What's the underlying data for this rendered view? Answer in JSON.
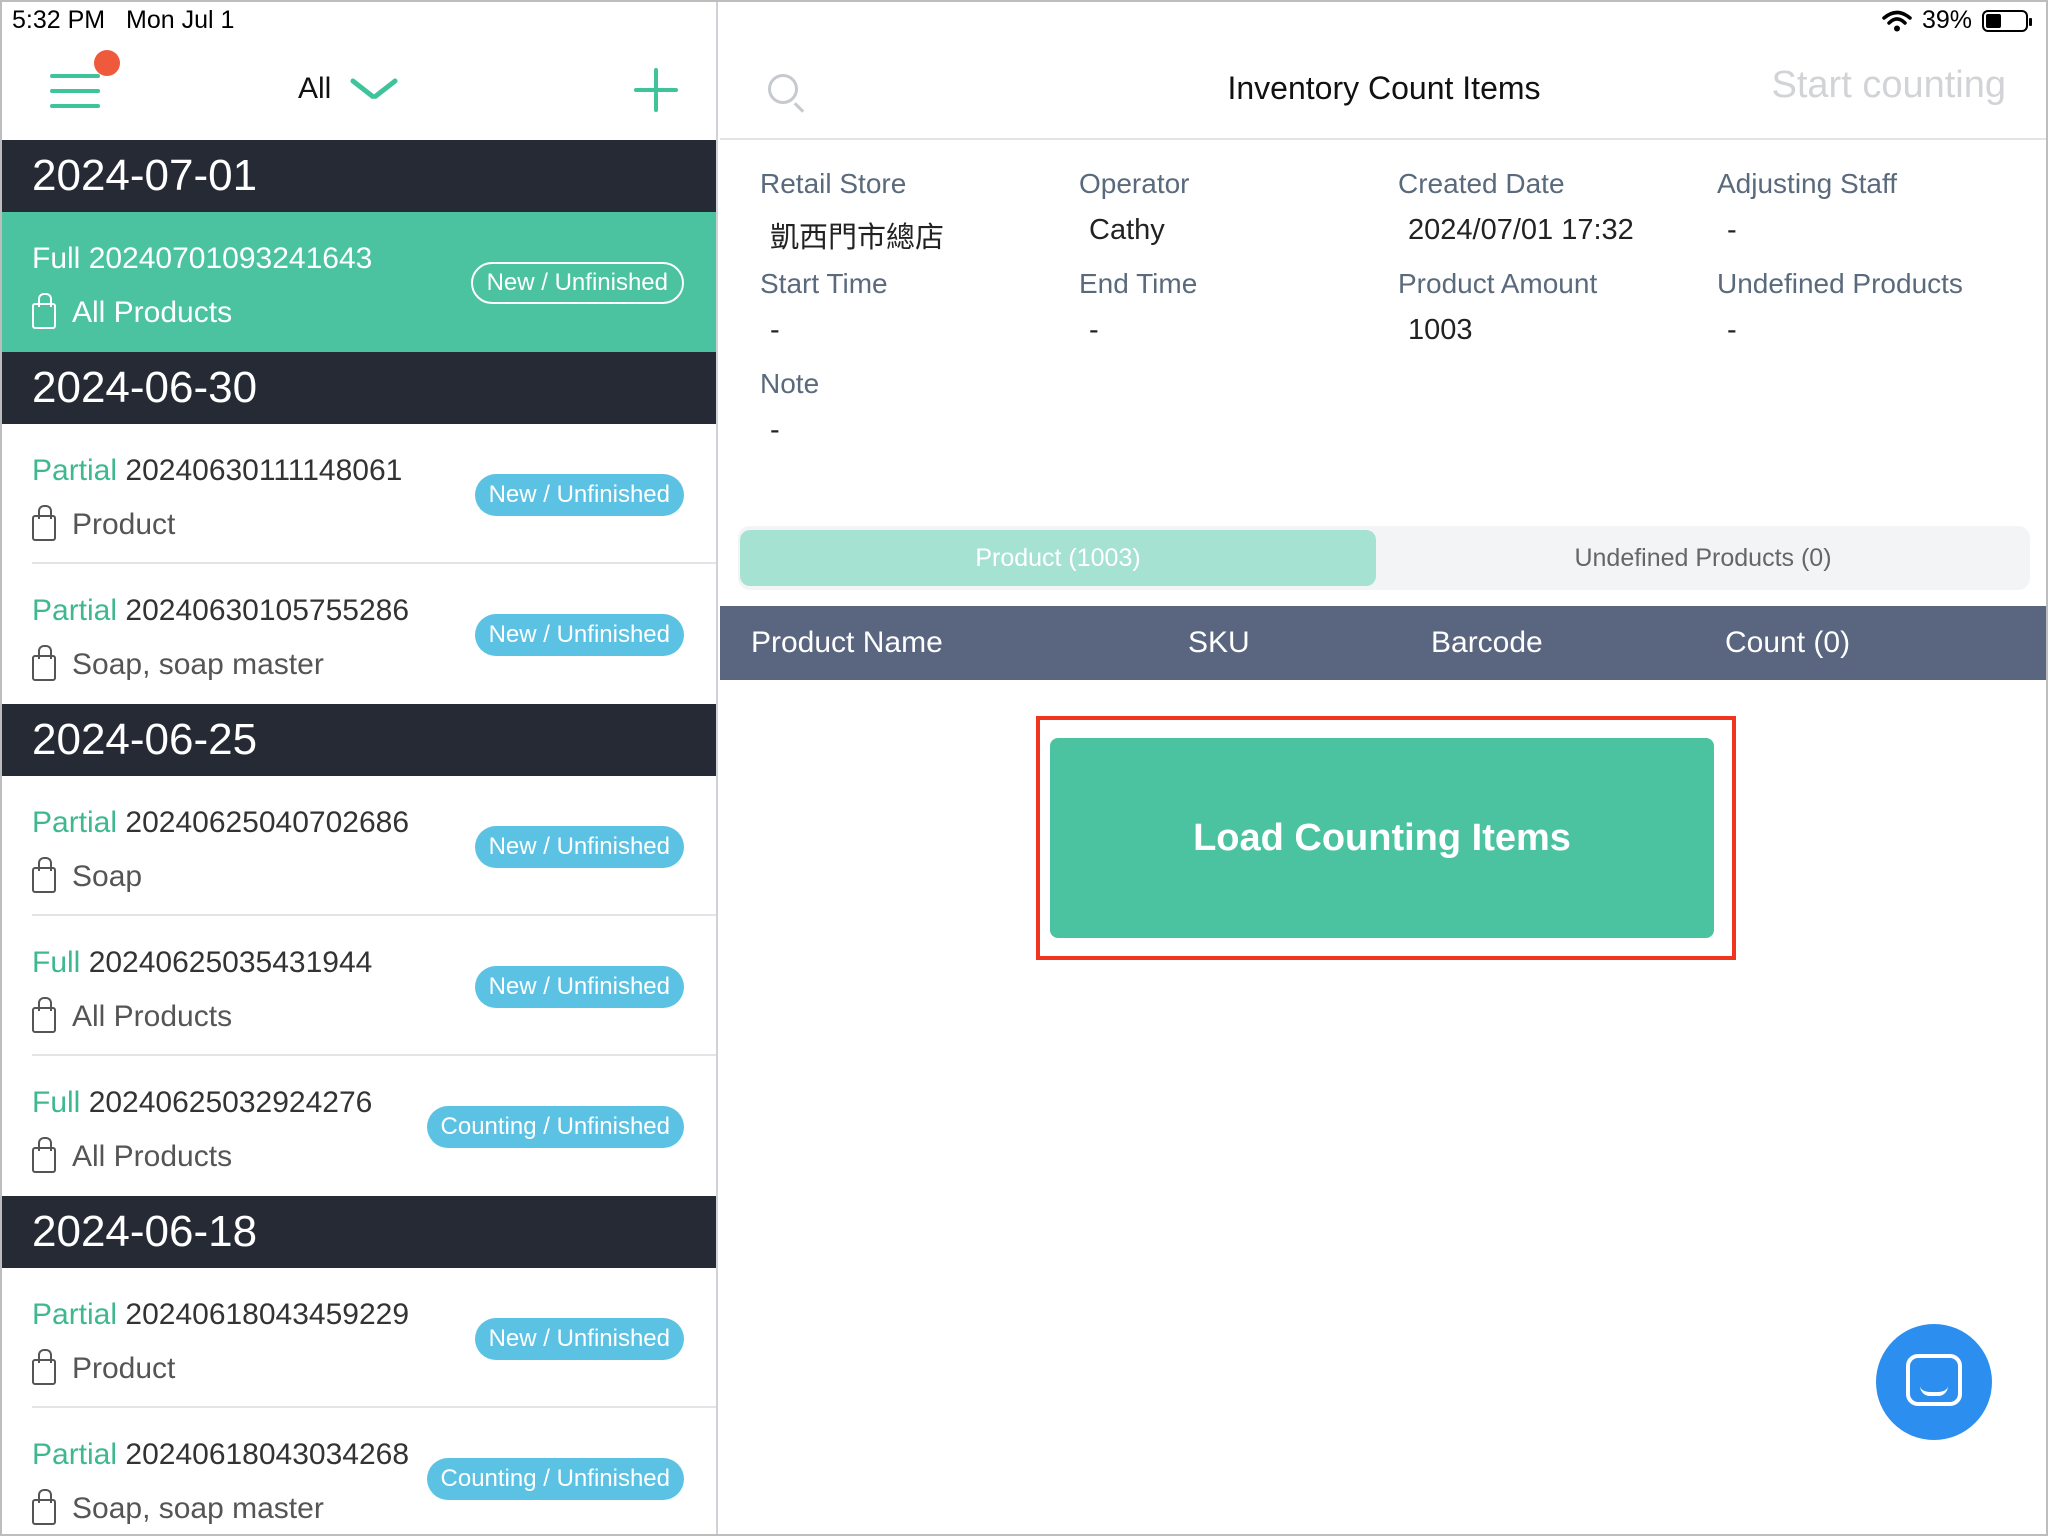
{
  "status_bar": {
    "time": "5:32 PM",
    "date": "Mon Jul 1",
    "battery": "39%",
    "battery_level": 0.39
  },
  "left_header": {
    "filter_label": "All"
  },
  "groups": [
    {
      "date": "2024-07-01",
      "items": [
        {
          "type": "Full",
          "id": "20240701093241643",
          "scope": "All Products",
          "status": "New / Unfinished",
          "selected": true
        }
      ]
    },
    {
      "date": "2024-06-30",
      "items": [
        {
          "type": "Partial",
          "id": "20240630111148061",
          "scope": "Product",
          "status": "New / Unfinished"
        },
        {
          "type": "Partial",
          "id": "20240630105755286",
          "scope": "Soap, soap master",
          "status": "New / Unfinished"
        }
      ]
    },
    {
      "date": "2024-06-25",
      "items": [
        {
          "type": "Partial",
          "id": "20240625040702686",
          "scope": "Soap",
          "status": "New / Unfinished"
        },
        {
          "type": "Full",
          "id": "20240625035431944",
          "scope": "All Products",
          "status": "New / Unfinished"
        },
        {
          "type": "Full",
          "id": "20240625032924276",
          "scope": "All Products",
          "status": "Counting / Unfinished"
        }
      ]
    },
    {
      "date": "2024-06-18",
      "items": [
        {
          "type": "Partial",
          "id": "20240618043459229",
          "scope": "Product",
          "status": "New / Unfinished"
        },
        {
          "type": "Partial",
          "id": "20240618043034268",
          "scope": "Soap, soap master",
          "status": "Counting / Unfinished"
        }
      ]
    }
  ],
  "right_header": {
    "title": "Inventory Count Items",
    "start_counting": "Start counting"
  },
  "details": {
    "retail_store": {
      "label": "Retail Store",
      "value": "凱西門市總店"
    },
    "operator": {
      "label": "Operator",
      "value": "Cathy"
    },
    "created_date": {
      "label": "Created Date",
      "value": "2024/07/01 17:32"
    },
    "adjusting_staff": {
      "label": "Adjusting Staff",
      "value": "-"
    },
    "start_time": {
      "label": "Start Time",
      "value": "-"
    },
    "end_time": {
      "label": "End Time",
      "value": "-"
    },
    "product_amount": {
      "label": "Product Amount",
      "value": "1003"
    },
    "undefined_products": {
      "label": "Undefined Products",
      "value": "-"
    },
    "note": {
      "label": "Note",
      "value": "-"
    }
  },
  "tabs": {
    "product": "Product (1003)",
    "undefined": "Undefined Products (0)"
  },
  "table": {
    "product_name": "Product Name",
    "sku": "SKU",
    "barcode": "Barcode",
    "count": "Count (0)"
  },
  "load_button": "Load Counting Items",
  "colors": {
    "accent": "#4bc3a0",
    "header_dark": "#262a35",
    "badge": "#5bc2e3",
    "highlight": "#f0351e",
    "table_header": "#5a6580",
    "fab": "#2c8ff0"
  }
}
